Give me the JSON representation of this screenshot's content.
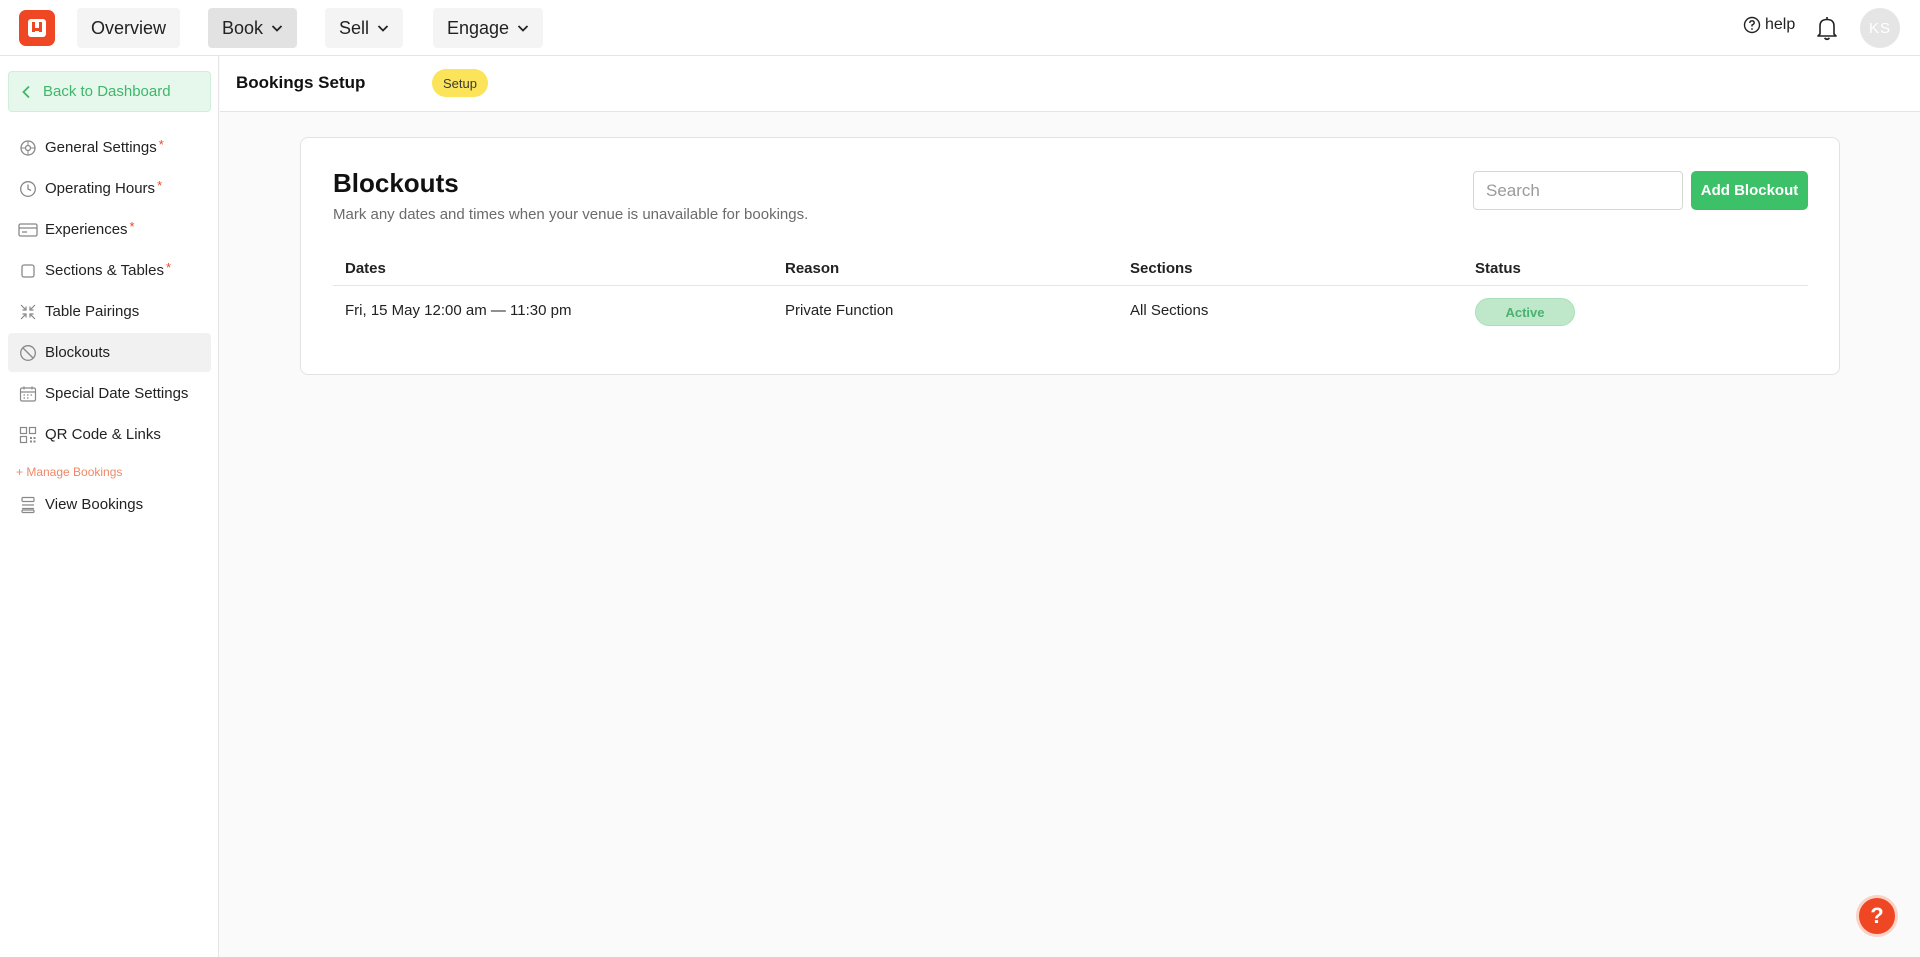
{
  "nav": {
    "items": [
      {
        "label": "Overview",
        "has_dropdown": false
      },
      {
        "label": "Book",
        "has_dropdown": true,
        "active": true
      },
      {
        "label": "Sell",
        "has_dropdown": true
      },
      {
        "label": "Engage",
        "has_dropdown": true
      }
    ],
    "help_label": "help",
    "avatar_initials": "KS"
  },
  "sidebar": {
    "back_label": "Back to Dashboard",
    "items": [
      {
        "label": "General Settings",
        "icon": "gear-icon",
        "required_mark": "*"
      },
      {
        "label": "Operating Hours",
        "icon": "clock-icon",
        "required_mark": "*"
      },
      {
        "label": "Experiences",
        "icon": "card-icon",
        "required_mark": "*"
      },
      {
        "label": "Sections & Tables",
        "icon": "square-icon",
        "required_mark": "*"
      },
      {
        "label": "Table Pairings",
        "icon": "merge-arrows-icon"
      },
      {
        "label": "Blockouts",
        "icon": "block-icon",
        "active": true
      },
      {
        "label": "Special Date Settings",
        "icon": "calendar-icon"
      },
      {
        "label": "QR Code & Links",
        "icon": "qr-code-icon"
      }
    ],
    "section_label": "+ Manage Bookings",
    "manage_items": [
      {
        "label": "View Bookings",
        "icon": "stack-icon"
      }
    ]
  },
  "header": {
    "title": "Bookings Setup",
    "badge": "Setup"
  },
  "blockouts": {
    "title": "Blockouts",
    "subtitle": "Mark any dates and times when your venue is unavailable for bookings.",
    "search_placeholder": "Search",
    "add_button": "Add Blockout",
    "columns": [
      "Dates",
      "Reason",
      "Sections",
      "Status"
    ],
    "rows": [
      {
        "dates": "Fri, 15 May 12:00 am — 11:30 pm",
        "reason": "Private Function",
        "sections": "All Sections",
        "status": "Active"
      }
    ]
  },
  "colors": {
    "brand": "#ef4623",
    "primary_green": "#3cc068",
    "badge_yellow": "#fbe35a"
  },
  "fab_symbol": "?"
}
